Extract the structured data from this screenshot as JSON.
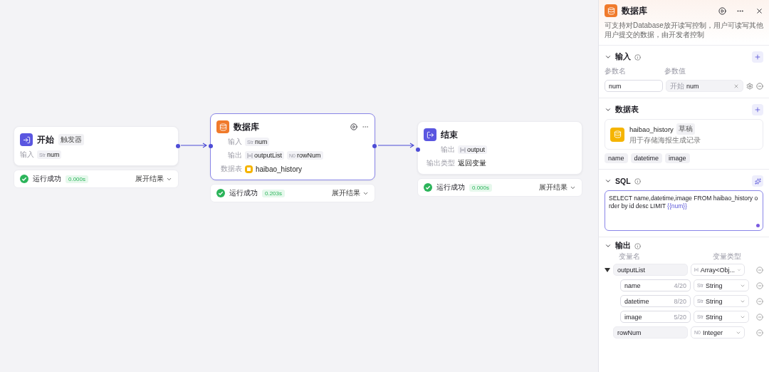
{
  "canvas": {
    "nodes": [
      {
        "kind": "start",
        "title": "开始",
        "badge": "触发器",
        "rows": [
          {
            "label": "输入",
            "vars": [
              {
                "kind": "string",
                "tag": "Str",
                "name": "num"
              }
            ]
          }
        ],
        "status": {
          "text": "运行成功",
          "time": "0.000s",
          "action": "展开结果"
        },
        "selected": false
      },
      {
        "kind": "database",
        "title": "数据库",
        "rows": [
          {
            "label": "输入",
            "vars": [
              {
                "kind": "string",
                "tag": "Str",
                "name": "num"
              }
            ]
          },
          {
            "label": "输出",
            "vars": [
              {
                "kind": "array",
                "name": "outputList"
              },
              {
                "kind": "number",
                "tag": "N0",
                "name": "rowNum"
              }
            ]
          },
          {
            "label": "数据表",
            "table": "haibao_history"
          }
        ],
        "status": {
          "text": "运行成功",
          "time": "0.203s",
          "action": "展开结果"
        },
        "selected": true
      },
      {
        "kind": "end",
        "title": "结束",
        "rows": [
          {
            "label": "输出",
            "vars": [
              {
                "kind": "array",
                "name": "output"
              }
            ]
          },
          {
            "label": "输出类型",
            "value": "返回变量"
          }
        ],
        "status": {
          "text": "运行成功",
          "time": "0.000s",
          "action": "展开结果"
        },
        "selected": false
      }
    ]
  },
  "panel": {
    "title": "数据库",
    "description": "可支持对Database放开读写控制，用户可读写其他用户提交的数据，由开发者控制",
    "input": {
      "title": "输入",
      "col_name": "参数名",
      "col_value": "参数值",
      "params": [
        {
          "name": "num",
          "source": "开始",
          "value": "num"
        }
      ]
    },
    "tables": {
      "title": "数据表",
      "items": [
        {
          "name": "haibao_history",
          "badge": "草稿",
          "description": "用于存储海报生成记录"
        }
      ],
      "fields": [
        "name",
        "datetime",
        "image"
      ]
    },
    "sql": {
      "title": "SQL",
      "text": "SELECT name,datetime,image FROM haibao_history  order by id  desc LIMIT ",
      "variable": "{{num}}"
    },
    "output": {
      "title": "输出",
      "col_name": "变量名",
      "col_type": "变量类型",
      "vars": [
        {
          "name": "outputList",
          "kind": "array",
          "type": "Array<Obj...",
          "expanded": true,
          "children": [
            {
              "name": "name",
              "count": "4/20",
              "kind": "string",
              "tag": "Str",
              "type": "String"
            },
            {
              "name": "datetime",
              "count": "8/20",
              "kind": "string",
              "tag": "Str",
              "type": "String"
            },
            {
              "name": "image",
              "count": "5/20",
              "kind": "string",
              "tag": "Str",
              "type": "String"
            }
          ]
        },
        {
          "name": "rowNum",
          "kind": "number",
          "tag": "N0",
          "type": "Integer"
        }
      ]
    }
  }
}
